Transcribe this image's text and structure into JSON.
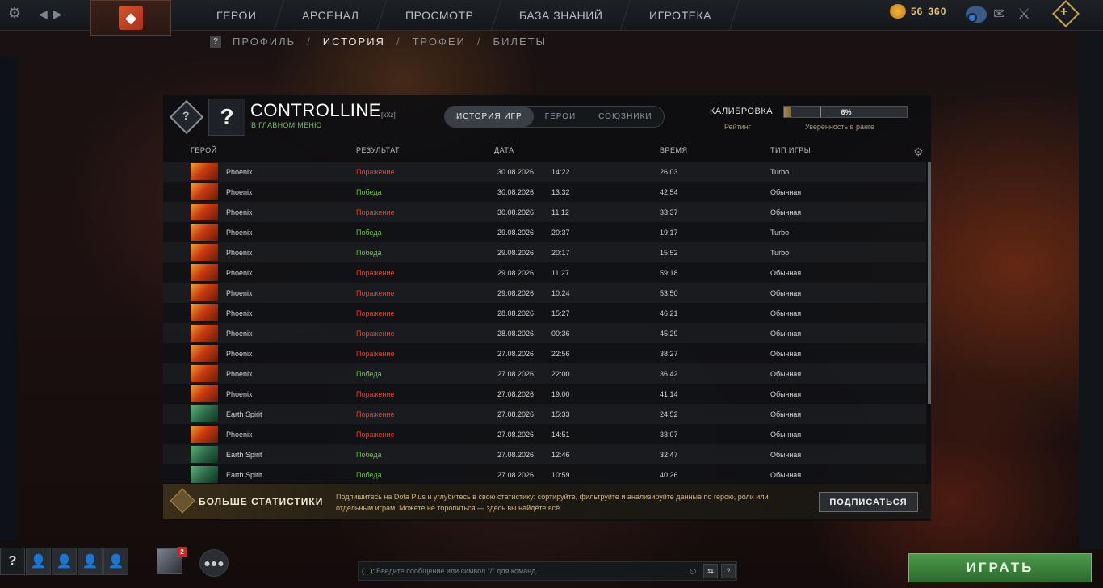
{
  "topbar": {
    "nav": [
      "ГЕРОИ",
      "АРСЕНАЛ",
      "ПРОСМОТР",
      "БАЗА ЗНАНИЙ",
      "ИГРОТЕКА"
    ],
    "currency_a": "56",
    "currency_b": "360",
    "icons": [
      "gear-icon",
      "back-arrow-icon",
      "forward-arrow-icon",
      "dota-logo-icon",
      "coins-icon",
      "chat-icon",
      "mail-icon",
      "armory-icon",
      "dota-plus-icon"
    ]
  },
  "subnav": {
    "help": "?",
    "items": [
      "ПРОФИЛЬ",
      "ИСТОРИЯ",
      "ТРОФЕИ",
      "БИЛЕТЫ"
    ],
    "separator": "/",
    "active": "ИСТОРИЯ"
  },
  "profile": {
    "avatar_glyph": "?",
    "name": "CONTROLLINE",
    "tag": "[xXz]",
    "status": "В ГЛАВНОМ МЕНЮ",
    "tabs": [
      "ИСТОРИЯ ИГР",
      "ГЕРОИ",
      "СОЮЗНИКИ"
    ],
    "active_tab": "ИСТОРИЯ ИГР",
    "calibration_label": "КАЛИБРОВКА",
    "calibration_progress_pct": 6,
    "calibration_value": "6%",
    "rating_label": "Рейтинг",
    "confidence_label": "Уверенность в ранге"
  },
  "table": {
    "headers": [
      "ГЕРОЙ",
      "РЕЗУЛЬТАТ",
      "ДАТА",
      "ВРЕМЯ",
      "ТИП ИГРЫ"
    ],
    "rows": [
      {
        "hero": "Phoenix",
        "result": "Поражение",
        "outcome": "loss",
        "date": "30.08.2026",
        "time": "14:22",
        "duration": "26:03",
        "mode": "Turbo"
      },
      {
        "hero": "Phoenix",
        "result": "Победа",
        "outcome": "win",
        "date": "30.08.2026",
        "time": "13:32",
        "duration": "42:54",
        "mode": "Обычная"
      },
      {
        "hero": "Phoenix",
        "result": "Поражение",
        "outcome": "loss",
        "date": "30.08.2026",
        "time": "11:12",
        "duration": "33:37",
        "mode": "Обычная"
      },
      {
        "hero": "Phoenix",
        "result": "Победа",
        "outcome": "win",
        "date": "29.08.2026",
        "time": "20:37",
        "duration": "19:17",
        "mode": "Turbo"
      },
      {
        "hero": "Phoenix",
        "result": "Победа",
        "outcome": "win",
        "date": "29.08.2026",
        "time": "20:17",
        "duration": "15:52",
        "mode": "Turbo"
      },
      {
        "hero": "Phoenix",
        "result": "Поражение",
        "outcome": "loss",
        "date": "29.08.2026",
        "time": "11:27",
        "duration": "59:18",
        "mode": "Обычная"
      },
      {
        "hero": "Phoenix",
        "result": "Поражение",
        "outcome": "loss",
        "date": "29.08.2026",
        "time": "10:24",
        "duration": "53:50",
        "mode": "Обычная"
      },
      {
        "hero": "Phoenix",
        "result": "Поражение",
        "outcome": "loss",
        "date": "28.08.2026",
        "time": "15:27",
        "duration": "46:21",
        "mode": "Обычная"
      },
      {
        "hero": "Phoenix",
        "result": "Поражение",
        "outcome": "loss",
        "date": "28.08.2026",
        "time": "00:36",
        "duration": "45:29",
        "mode": "Обычная"
      },
      {
        "hero": "Phoenix",
        "result": "Поражение",
        "outcome": "loss",
        "date": "27.08.2026",
        "time": "22:56",
        "duration": "38:27",
        "mode": "Обычная"
      },
      {
        "hero": "Phoenix",
        "result": "Победа",
        "outcome": "win",
        "date": "27.08.2026",
        "time": "22:00",
        "duration": "36:42",
        "mode": "Обычная"
      },
      {
        "hero": "Phoenix",
        "result": "Поражение",
        "outcome": "loss",
        "date": "27.08.2026",
        "time": "19:00",
        "duration": "41:14",
        "mode": "Обычная"
      },
      {
        "hero": "Earth Spirit",
        "result": "Поражение",
        "outcome": "loss",
        "date": "27.08.2026",
        "time": "15:33",
        "duration": "24:52",
        "mode": "Обычная"
      },
      {
        "hero": "Phoenix",
        "result": "Поражение",
        "outcome": "loss",
        "date": "27.08.2026",
        "time": "14:51",
        "duration": "33:07",
        "mode": "Обычная"
      },
      {
        "hero": "Earth Spirit",
        "result": "Победа",
        "outcome": "win",
        "date": "27.08.2026",
        "time": "12:46",
        "duration": "32:47",
        "mode": "Обычная"
      },
      {
        "hero": "Earth Spirit",
        "result": "Победа",
        "outcome": "win",
        "date": "27.08.2026",
        "time": "10:59",
        "duration": "40:26",
        "mode": "Обычная"
      }
    ]
  },
  "plus_banner": {
    "title": "БОЛЬШЕ СТАТИСТИКИ",
    "text": "Подпишитесь на Dota Plus и углубитесь в свою статистику: сортируйте, фильтруйте и анализируйте данные по герою, роли или отдельным играм. Можете не торопиться — здесь вы найдёте всё.",
    "button": "ПОДПИСАТЬСЯ"
  },
  "bottombar": {
    "party_help": "?",
    "notification_count": "2",
    "chat_prefix": "(...):",
    "chat_placeholder": "Введите сообщение или символ \"/\" для команд.",
    "chat_help": "?",
    "play_button": "ИГРАТЬ"
  },
  "colors": {
    "win": "#6cc04a",
    "loss": "#e0452f",
    "accent_gold": "#d9b46a",
    "play_green": "#3e823e"
  }
}
